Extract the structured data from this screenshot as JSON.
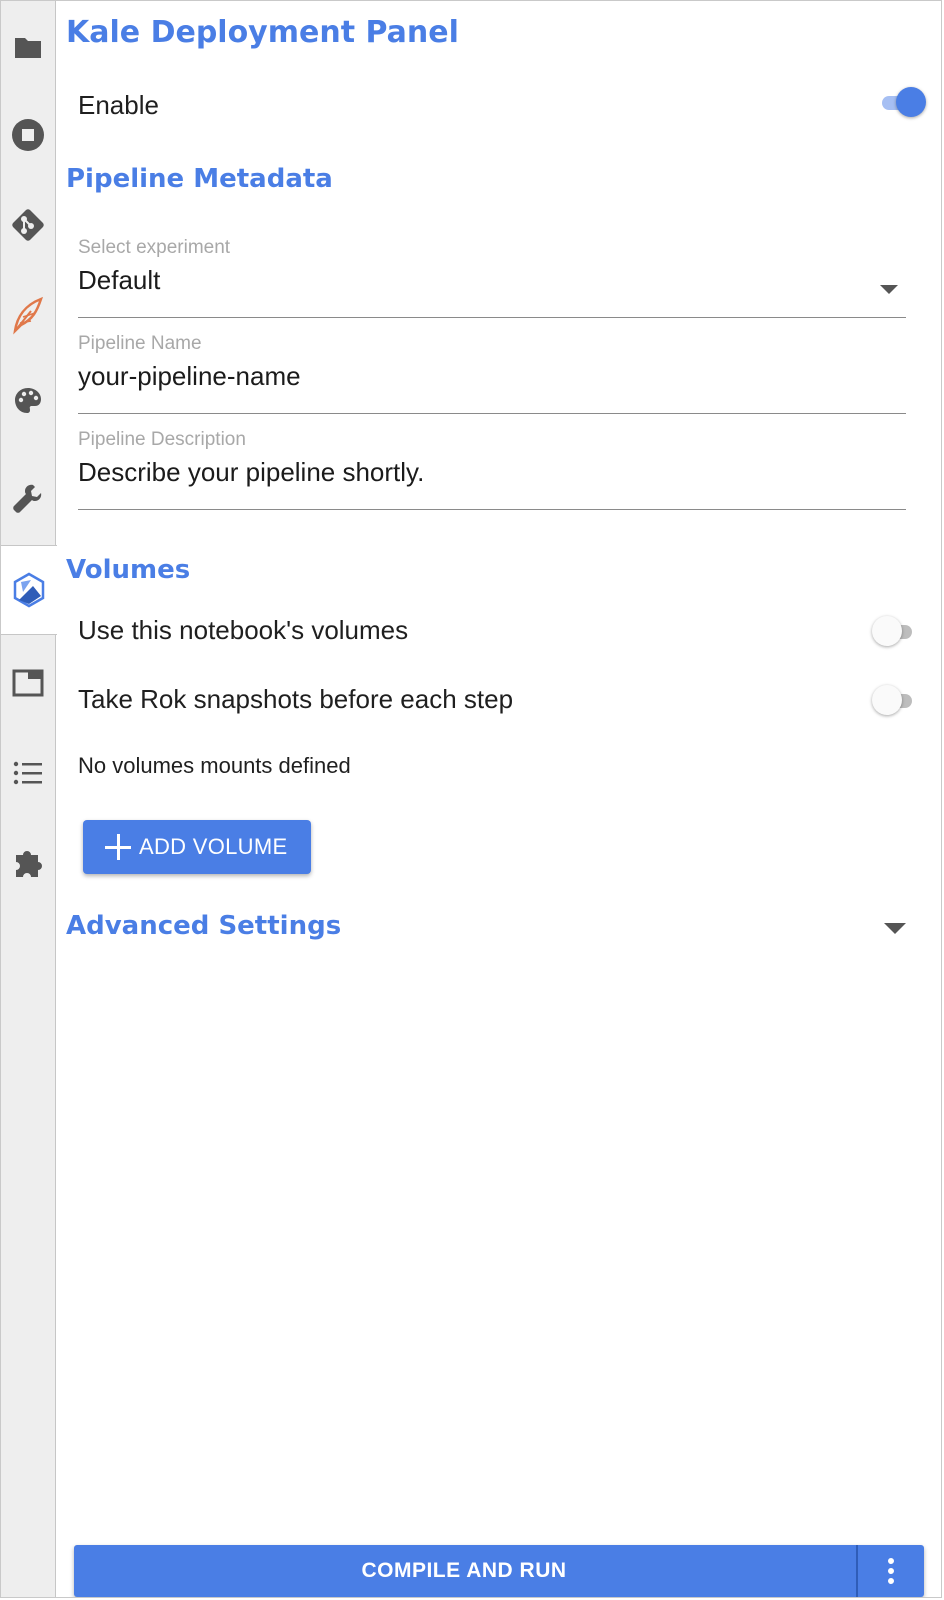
{
  "panel": {
    "title": "Kale Deployment Panel",
    "enable_label": "Enable",
    "enable_on": true
  },
  "metadata": {
    "heading": "Pipeline Metadata",
    "experiment_label": "Select experiment",
    "experiment_value": "Default",
    "name_label": "Pipeline Name",
    "name_value": "your-pipeline-name",
    "description_label": "Pipeline Description",
    "description_value": "Describe your pipeline shortly."
  },
  "volumes": {
    "heading": "Volumes",
    "use_notebook_volumes_label": "Use this notebook's volumes",
    "use_notebook_volumes_on": false,
    "rok_snapshots_label": "Take Rok snapshots before each step",
    "rok_snapshots_on": false,
    "empty_text": "No volumes mounts defined",
    "add_button_label": "ADD VOLUME"
  },
  "advanced": {
    "heading": "Advanced Settings"
  },
  "actions": {
    "compile_run_label": "COMPILE AND RUN"
  },
  "sidebar": {
    "icons": [
      "folder-icon",
      "stop-circle-icon",
      "git-icon",
      "kubeflow-feather-icon",
      "palette-icon",
      "wrench-icon",
      "kale-icon",
      "tab-window-icon",
      "list-icon",
      "puzzle-piece-icon"
    ]
  },
  "colors": {
    "accent": "#4a7ee5",
    "sidebar_bg": "#eeeeee",
    "icon_gray": "#555555",
    "feather_orange": "#e0784a"
  }
}
